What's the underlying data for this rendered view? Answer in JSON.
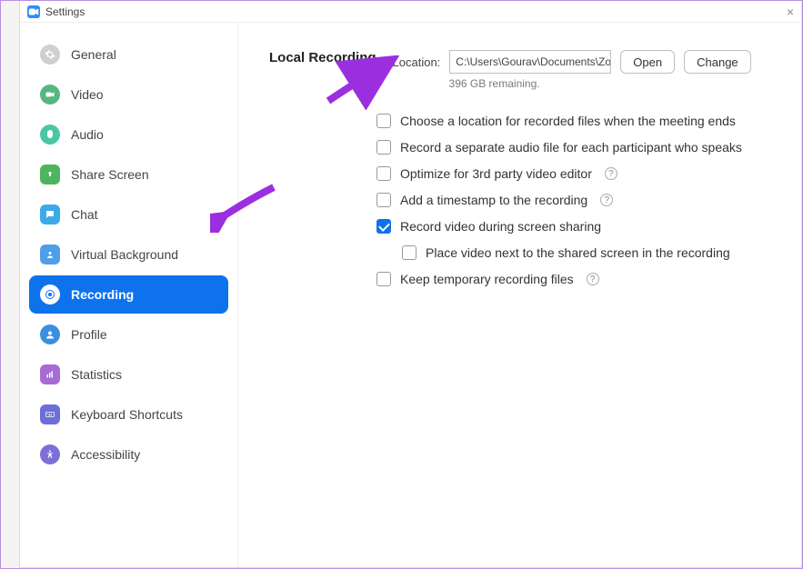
{
  "window": {
    "title": "Settings"
  },
  "sidebar": {
    "items": [
      {
        "label": "General",
        "icon": "gear-icon",
        "active": false
      },
      {
        "label": "Video",
        "icon": "video-icon",
        "active": false
      },
      {
        "label": "Audio",
        "icon": "audio-icon",
        "active": false
      },
      {
        "label": "Share Screen",
        "icon": "share-screen-icon",
        "active": false
      },
      {
        "label": "Chat",
        "icon": "chat-icon",
        "active": false
      },
      {
        "label": "Virtual Background",
        "icon": "virtual-background-icon",
        "active": false
      },
      {
        "label": "Recording",
        "icon": "recording-icon",
        "active": true
      },
      {
        "label": "Profile",
        "icon": "profile-icon",
        "active": false
      },
      {
        "label": "Statistics",
        "icon": "statistics-icon",
        "active": false
      },
      {
        "label": "Keyboard Shortcuts",
        "icon": "keyboard-icon",
        "active": false
      },
      {
        "label": "Accessibility",
        "icon": "accessibility-icon",
        "active": false
      }
    ]
  },
  "main": {
    "section_title": "Local Recording",
    "location_label": "Location:",
    "location_path": "C:\\Users\\Gourav\\Documents\\Zo",
    "open_label": "Open",
    "change_label": "Change",
    "remaining_text": "396 GB remaining.",
    "options": [
      {
        "label": "Choose a location for recorded files when the meeting ends",
        "checked": false,
        "help": false,
        "indent": false
      },
      {
        "label": "Record a separate audio file for each participant who speaks",
        "checked": false,
        "help": false,
        "indent": false
      },
      {
        "label": "Optimize for 3rd party video editor",
        "checked": false,
        "help": true,
        "indent": false
      },
      {
        "label": "Add a timestamp to the recording",
        "checked": false,
        "help": true,
        "indent": false
      },
      {
        "label": "Record video during screen sharing",
        "checked": true,
        "help": false,
        "indent": false
      },
      {
        "label": "Place video next to the shared screen in the recording",
        "checked": false,
        "help": false,
        "indent": true
      },
      {
        "label": "Keep temporary recording files",
        "checked": false,
        "help": true,
        "indent": false
      }
    ]
  },
  "annotations": {
    "arrow1": "purple-arrow",
    "arrow2": "purple-arrow"
  }
}
